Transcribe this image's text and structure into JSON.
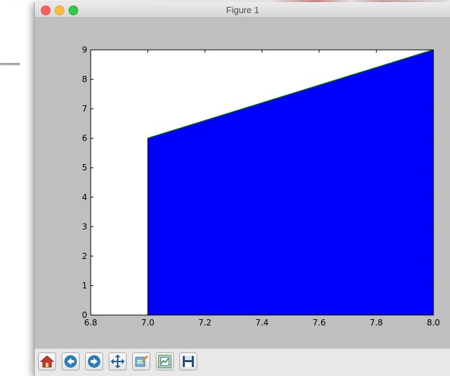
{
  "window": {
    "title": "Figure 1"
  },
  "background": {
    "dashes": "====="
  },
  "chart_data": {
    "type": "area",
    "x": [
      7.0,
      8.0
    ],
    "y": [
      6,
      9
    ],
    "xlim": [
      6.8,
      8.0
    ],
    "ylim": [
      0,
      9
    ],
    "xticks": [
      "6.8",
      "7.0",
      "7.2",
      "7.4",
      "7.6",
      "7.8",
      "8.0"
    ],
    "yticks": [
      "0",
      "1",
      "2",
      "3",
      "4",
      "5",
      "6",
      "7",
      "8",
      "9"
    ],
    "fill_color": "#0000ff",
    "line_color": "#006400",
    "title": "",
    "xlabel": "",
    "ylabel": "",
    "grid": false
  },
  "toolbar": {
    "tools": [
      {
        "name": "home",
        "icon": "home-icon"
      },
      {
        "name": "back",
        "icon": "back-arrow-icon"
      },
      {
        "name": "forward",
        "icon": "forward-arrow-icon"
      },
      {
        "name": "pan",
        "icon": "pan-icon"
      },
      {
        "name": "zoom",
        "icon": "zoom-icon"
      },
      {
        "name": "configure-subplots",
        "icon": "subplots-icon"
      },
      {
        "name": "save",
        "icon": "save-icon"
      }
    ]
  }
}
